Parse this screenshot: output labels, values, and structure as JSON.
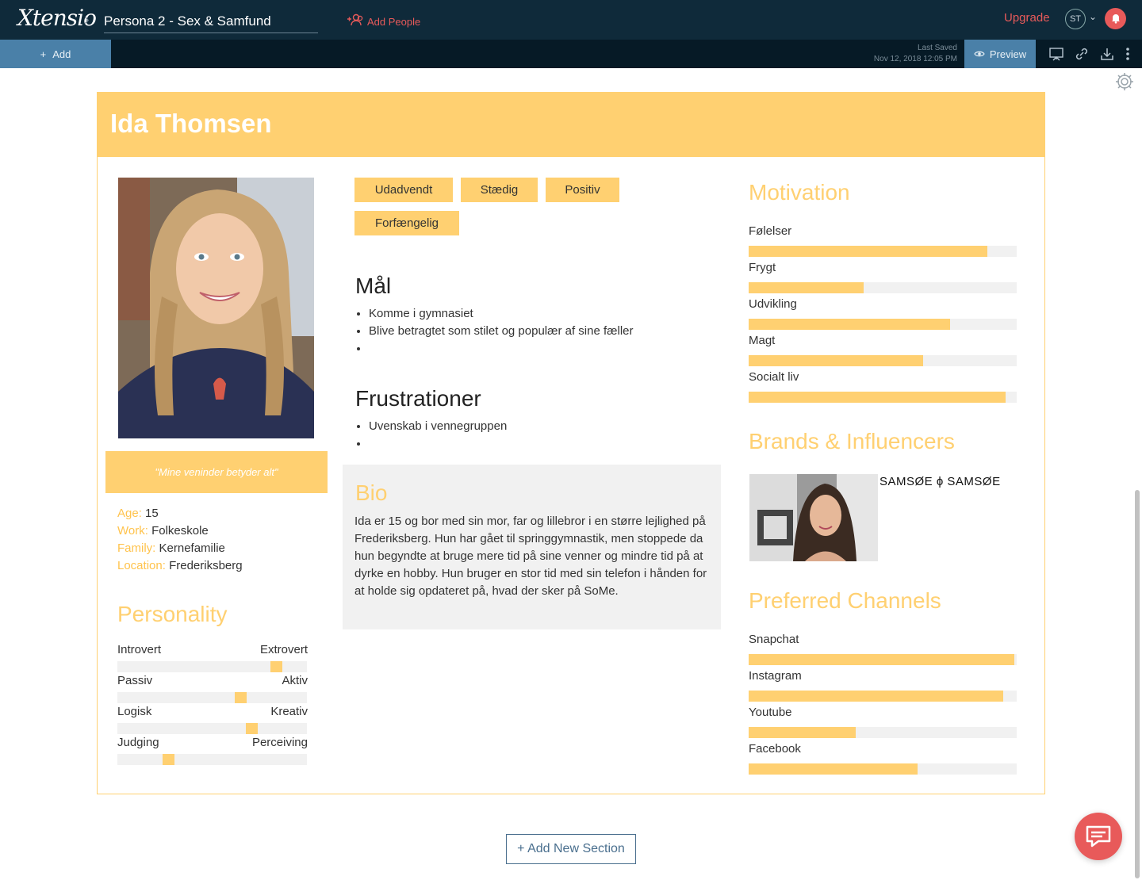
{
  "app": {
    "logo": "Xtensio",
    "document_title": "Persona 2 - Sex & Samfund",
    "add_people_label": "Add People",
    "upgrade_label": "Upgrade",
    "avatar_initials": "ST",
    "add_label": "Add",
    "last_saved_label": "Last Saved",
    "last_saved_time": "Nov 12, 2018 12:05 PM",
    "preview_label": "Preview",
    "add_section_label": "+ Add New Section"
  },
  "colors": {
    "accent": "#ffd071",
    "topbar": "#0f2a3a",
    "button_blue": "#4a80a8",
    "alert_red": "#e85a5a"
  },
  "persona": {
    "name": "Ida Thomsen",
    "quote": "\"Mine veninder betyder alt\"",
    "facts": [
      {
        "key": "Age:",
        "value": "15"
      },
      {
        "key": "Work:",
        "value": "Folkeskole"
      },
      {
        "key": "Family:",
        "value": "Kernefamilie"
      },
      {
        "key": "Location:",
        "value": "Frederiksberg"
      }
    ],
    "traits": [
      "Udadvendt",
      "Stædig",
      "Positiv",
      "Forfængelig"
    ],
    "personality": {
      "title": "Personality",
      "scales": [
        {
          "left": "Introvert",
          "right": "Extrovert",
          "level": 0.84
        },
        {
          "left": "Passiv",
          "right": "Aktiv",
          "level": 0.65
        },
        {
          "left": "Logisk",
          "right": "Kreativ",
          "level": 0.71
        },
        {
          "left": "Judging",
          "right": "Perceiving",
          "level": 0.27
        }
      ]
    },
    "goals": {
      "title": "Mål",
      "items": [
        "Komme i gymnasiet",
        "Blive betragtet som stilet og populær af sine fæller",
        ""
      ]
    },
    "frustrations": {
      "title": "Frustrationer",
      "items": [
        "Uvenskab i vennegruppen",
        ""
      ]
    },
    "bio": {
      "title": "Bio",
      "text": "Ida er 15 og bor med sin mor, far og lillebror i en større lejlighed på Frederiksberg. Hun har gået til springgymnastik, men stoppede da hun begyndte at bruge mere tid på sine venner og mindre tid på at dyrke en hobby. Hun bruger en stor tid med sin telefon i hånden for at holde sig opdateret på, hvad der sker på SoMe."
    },
    "motivation": {
      "title": "Motivation",
      "bars": [
        {
          "label": "Følelser",
          "value": 0.89
        },
        {
          "label": "Frygt",
          "value": 0.43
        },
        {
          "label": "Udvikling",
          "value": 0.75
        },
        {
          "label": "Magt",
          "value": 0.65
        },
        {
          "label": "Socialt liv",
          "value": 0.96
        }
      ]
    },
    "brands": {
      "title": "Brands & Influencers",
      "logo_text": "SAMSØE ϕ SAMSØE"
    },
    "channels": {
      "title": "Preferred Channels",
      "bars": [
        {
          "label": "Snapchat",
          "value": 0.99
        },
        {
          "label": "Instagram",
          "value": 0.95
        },
        {
          "label": "Youtube",
          "value": 0.4
        },
        {
          "label": "Facebook",
          "value": 0.63
        }
      ]
    }
  }
}
